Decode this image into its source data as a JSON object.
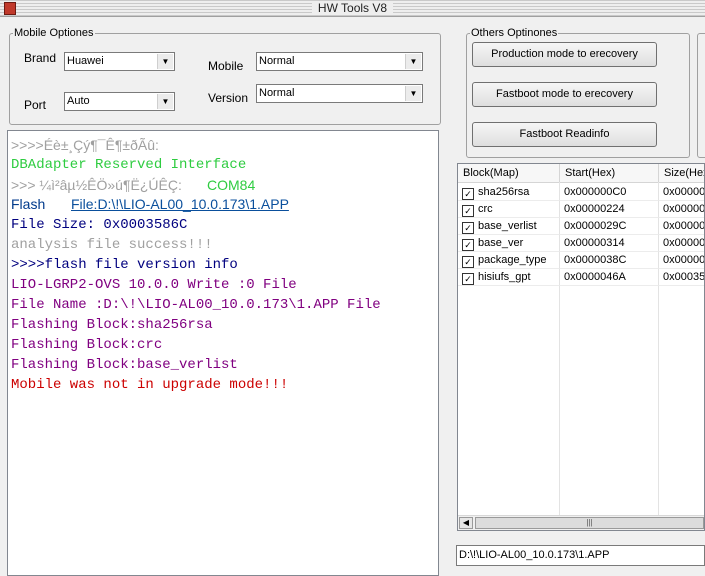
{
  "window": {
    "title": "HW Tools V8"
  },
  "mobile_options": {
    "legend": "Mobile Optiones",
    "brand_label": "Brand",
    "brand_value": "Huawei",
    "port_label": "Port",
    "port_value": "Auto",
    "mobile_label": "Mobile",
    "mobile_value": "Normal",
    "version_label": "Version",
    "version_value": "Normal"
  },
  "others_options": {
    "legend": "Others Optinones",
    "btn_production": "Production mode to erecovery",
    "btn_fastboot_erecovery": "Fastboot mode to erecovery",
    "btn_fastboot_readinfo": "Fastboot Readinfo"
  },
  "log": [
    {
      "text": ">>>>Éè±¸Çý¶¯Ê¶±ðÃû:",
      "color": "#a0a0a0",
      "font": "sans"
    },
    {
      "text": "   DBAdapter Reserved Interface",
      "color": "#2ecc40",
      "font": "mono"
    },
    {
      "text": ">>> ¼ì²âµ½ÊÖ»ú¶Ë¿ÚÊÇ:",
      "color": "#a0a0a0",
      "font": "sans"
    },
    {
      "text": "COM84",
      "color": "#2ecc40",
      "font": "sans"
    },
    {
      "text": "  Flash ",
      "color": "#003a8c",
      "font": "sans"
    },
    {
      "text": "File:D:\\!\\LIO-AL00_10.0.173\\1.APP",
      "color": "#0a4f9c",
      "font": "sans"
    },
    {
      "text": "   File Size: 0x0003586C",
      "color": "#00007f",
      "font": "mono"
    },
    {
      "text": "   analysis file success!!!",
      "color": "#a0a0a0",
      "font": "mono"
    },
    {
      "text": ">>>>flash file version info",
      "color": "#00007f",
      "font": "mono"
    },
    {
      "text": "   LIO-LGRP2-OVS 10.0.0    Write :0 File",
      "color": "#800080",
      "font": "mono"
    },
    {
      "text": "   File Name :D:\\!\\LIO-AL00_10.0.173\\1.APP File",
      "color": "#800080",
      "font": "mono"
    },
    {
      "text": "   Flashing Block:sha256rsa",
      "color": "#800080",
      "font": "mono"
    },
    {
      "text": "   Flashing Block:crc",
      "color": "#800080",
      "font": "mono"
    },
    {
      "text": "   Flashing Block:base_verlist",
      "color": "#800080",
      "font": "mono"
    },
    {
      "text": "   Mobile was not in upgrade mode!!!",
      "color": "#cc0000",
      "font": "mono"
    }
  ],
  "block_table": {
    "columns": [
      "Block(Map)",
      "Start(Hex)",
      "Size(Hex"
    ],
    "rows": [
      {
        "checked": "✓",
        "block": "sha256rsa",
        "start": "0x000000C0",
        "size": "0x00000"
      },
      {
        "checked": "✓",
        "block": "crc",
        "start": "0x00000224",
        "size": "0x00000"
      },
      {
        "checked": "✓",
        "block": "base_verlist",
        "start": "0x0000029C",
        "size": "0x00000"
      },
      {
        "checked": "✓",
        "block": "base_ver",
        "start": "0x00000314",
        "size": "0x00000"
      },
      {
        "checked": "✓",
        "block": "package_type",
        "start": "0x0000038C",
        "size": "0x00000"
      },
      {
        "checked": "✓",
        "block": "hisiufs_gpt",
        "start": "0x0000046A",
        "size": "0x00035"
      }
    ]
  },
  "path_field": {
    "value": "D:\\!\\LIO-AL00_10.0.173\\1.APP"
  }
}
